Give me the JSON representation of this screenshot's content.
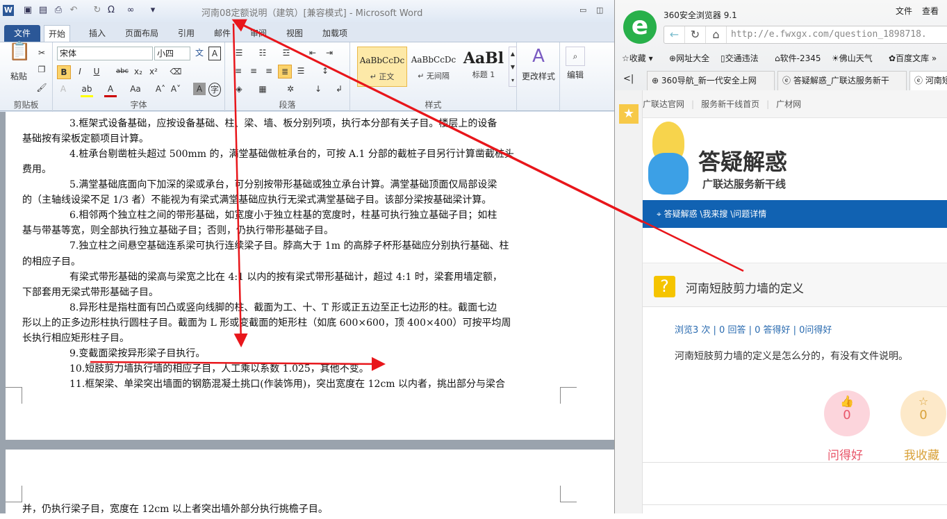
{
  "word": {
    "title": "河南08定额说明（建筑）[兼容模式] - Microsoft Word",
    "tabs": [
      "文件",
      "开始",
      "插入",
      "页面布局",
      "引用",
      "邮件",
      "审阅",
      "视图",
      "加载项"
    ],
    "groups": {
      "clipboard": "剪贴板",
      "font": "字体",
      "paragraph": "段落",
      "styles": "样式"
    },
    "paste": "粘贴",
    "font_name": "宋体",
    "font_size": "小四",
    "styles": [
      {
        "sample": "AaBbCcDc",
        "name": "↵ 正文"
      },
      {
        "sample": "AaBbCcDc",
        "name": "↵ 无间隔"
      },
      {
        "sample": "AaBl",
        "name": "标题 1"
      }
    ],
    "change_styles": "更改样式",
    "edit": "编辑",
    "lines": [
      "3.框架式设备基础，应按设备基础、柱、梁、墙、板分别列项，执行本分部有关子目。楼层上的设备",
      "基础按有梁板定额项目计算。",
      "4.桩承台剔凿桩头超过 500mm 的，满堂基础做桩承台的，可按 A.1 分部的截桩子目另行计算凿截桩头",
      "费用。",
      "5.满堂基础底面向下加深的梁或承台，可分别按带形基础或独立承台计算。满堂基础顶面仅局部设梁",
      "的（主轴线设梁不足 1/3 者）不能视为有梁式满堂基础应执行无梁式满堂基础子目。该部分梁按基础梁计算。",
      "6.相邻两个独立柱之间的带形基础，如宽度小于独立柱基的宽度时，柱基可执行独立基础子目；如柱",
      "基与带基等宽，则全部执行独立基础子目；否则，仍执行带形基础子目。",
      "7.独立柱之间悬空基础连系梁可执行连续梁子目。脖高大于 1m 的高脖子杯形基础应分别执行基础、柱",
      "的相应子目。",
      "有梁式带形基础的梁高与梁宽之比在 4:1 以内的按有梁式带形基础计，超过 4:1 时，梁套用墙定额，",
      "下部套用无梁式带形基础子目。",
      "8.异形柱是指柱面有凹凸或竖向线脚的柱、截面为工、十、T 形或正五边至正七边形的柱。截面七边",
      "形以上的正多边形柱执行圆柱子目。截面为 L 形或变截面的矩形柱（如底 600×600，顶 400×400）可按平均周",
      "长执行相应矩形柱子目。",
      "9.变截面梁按异形梁子目执行。",
      "10.短肢剪力墙执行墙的相应子目，人工乘以系数 1.025，其他不变。",
      "11.框架梁、单梁突出墙面的钢筋混凝土挑口(作装饰用)，突出宽度在 12cm 以内者，挑出部分与梁合"
    ],
    "page2_line": "并，仍执行梁子目，宽度在 12cm 以上者突出墙外部分执行挑檐子目。"
  },
  "browser": {
    "name": "360安全浏览器 9.1",
    "menu": [
      "文件",
      "查看"
    ],
    "url": "http://e.fwxgx.com/question_1898718.",
    "bookmarks": [
      "收藏",
      "网址大全",
      "交通违法",
      "软件-2345",
      "佛山天气",
      "百度文库"
    ],
    "tabs": [
      "360导航_新一代安全上网",
      "答疑解惑_广联达服务新干",
      "河南短"
    ],
    "site_nav": [
      "广联达官网",
      "服务新干线首页",
      "广材网"
    ],
    "banner_title": "答疑解惑",
    "banner_sub": "广联达服务新干线",
    "breadcrumb": "答疑解惑 \\我来搜 \\问题详情",
    "question_title": "河南短肢剪力墙的定义",
    "stats": "浏览3 次 | 0 回答 | 0 答得好 | 0问得好",
    "question_body": "河南短肢剪力墙的定义是怎么分的，有没有文件说明。",
    "good_count": "0",
    "good_label": "问得好",
    "fav_count": "0",
    "fav_label": "我收藏"
  },
  "colors": {
    "annotation": "#e8161b",
    "word_file_tab": "#2b5797",
    "crumb_bar": "#1162b2",
    "good": "#e8566a",
    "fav": "#d9a23a"
  }
}
